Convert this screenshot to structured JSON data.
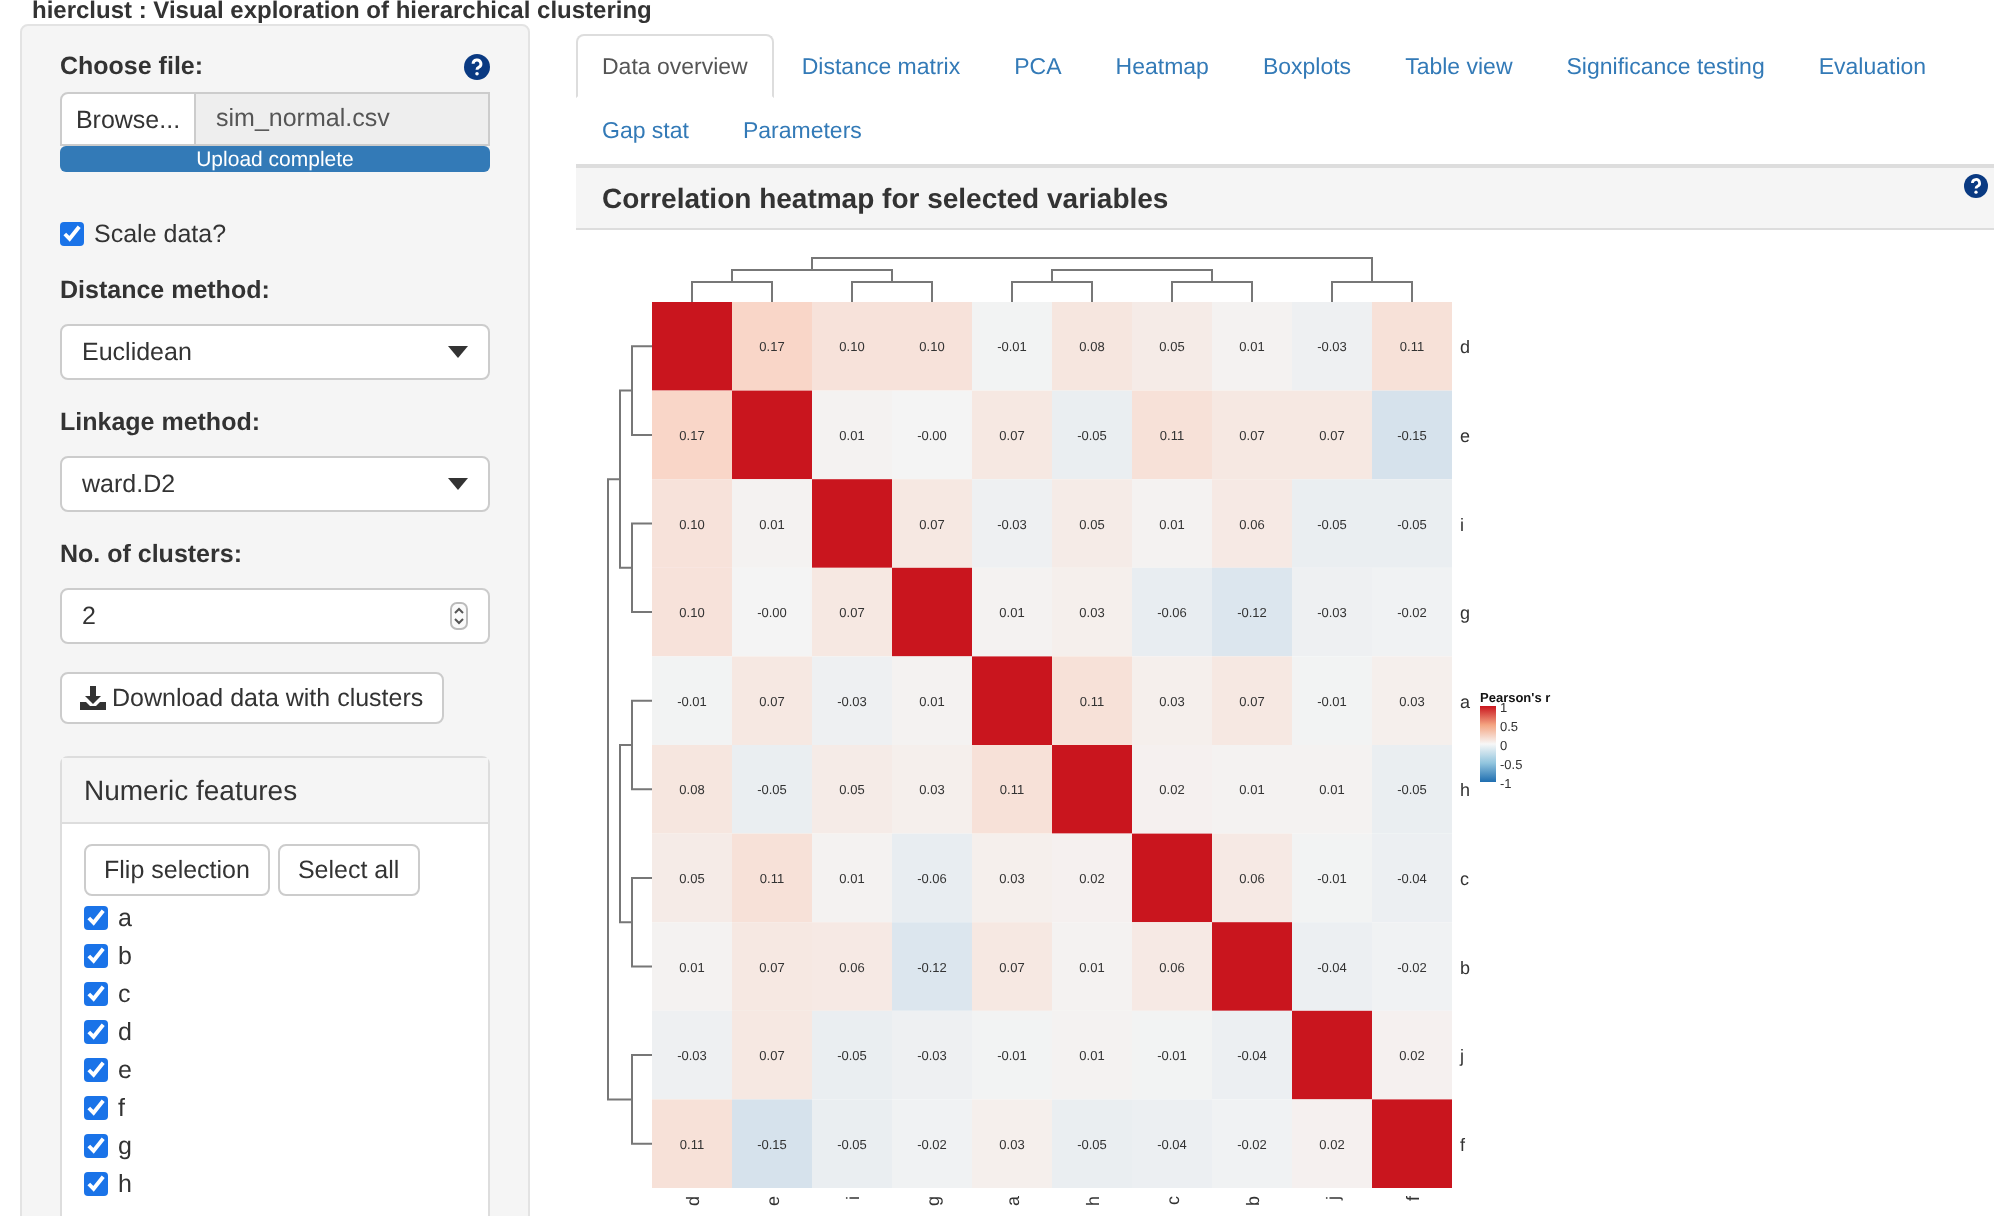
{
  "app_title": "hierclust : Visual exploration of hierarchical clustering",
  "sidebar": {
    "file_label": "Choose file:",
    "browse_button": "Browse...",
    "file_name": "sim_normal.csv",
    "upload": {
      "text": "Upload complete",
      "level": 1
    },
    "scale": {
      "label": "Scale data?",
      "checked": true
    },
    "distance": {
      "label": "Distance method:",
      "value": "Euclidean"
    },
    "linkage": {
      "label": "Linkage method:",
      "value": "ward.D2"
    },
    "clusters": {
      "label": "No. of clusters:",
      "value": "2"
    },
    "download_button": "Download data with clusters",
    "features": {
      "title": "Numeric features",
      "buttons": [
        "Flip selection",
        "Select all"
      ],
      "items": [
        {
          "label": "a",
          "checked": true
        },
        {
          "label": "b",
          "checked": true
        },
        {
          "label": "c",
          "checked": true
        },
        {
          "label": "d",
          "checked": true
        },
        {
          "label": "e",
          "checked": true
        },
        {
          "label": "f",
          "checked": true
        },
        {
          "label": "g",
          "checked": true
        },
        {
          "label": "h",
          "checked": true
        }
      ]
    }
  },
  "tabs": [
    [
      {
        "label": "Data overview",
        "selected": true
      },
      {
        "label": "Distance matrix",
        "selected": false
      },
      {
        "label": "PCA",
        "selected": false
      },
      {
        "label": "Heatmap",
        "selected": false
      },
      {
        "label": "Boxplots",
        "selected": false
      },
      {
        "label": "Table view",
        "selected": false
      },
      {
        "label": "Significance testing",
        "selected": false
      },
      {
        "label": "Evaluation",
        "selected": false
      }
    ],
    [
      {
        "label": "Gap stat",
        "selected": false
      },
      {
        "label": "Parameters",
        "selected": false
      }
    ]
  ],
  "panel": {
    "title": "Correlation heatmap for selected variables",
    "heatmap": {
      "rows": [
        {
          "label": "d",
          "cells": [
            {
              "kind": "diagonal"
            },
            {
              "kind": "value",
              "text": "0.17"
            },
            {
              "kind": "value",
              "text": "0.10"
            },
            {
              "kind": "value",
              "text": "0.10"
            },
            {
              "kind": "value",
              "text": "-0.01"
            },
            {
              "kind": "value",
              "text": "0.08"
            },
            {
              "kind": "value",
              "text": "0.05"
            },
            {
              "kind": "value",
              "text": "0.01"
            },
            {
              "kind": "value",
              "text": "-0.03"
            },
            {
              "kind": "value",
              "text": "0.11"
            }
          ]
        },
        {
          "label": "e",
          "cells": [
            {
              "kind": "value",
              "text": "0.17"
            },
            {
              "kind": "diagonal"
            },
            {
              "kind": "value",
              "text": "0.01"
            },
            {
              "kind": "value",
              "text": "-0.00"
            },
            {
              "kind": "value",
              "text": "0.07"
            },
            {
              "kind": "value",
              "text": "-0.05"
            },
            {
              "kind": "value",
              "text": "0.11"
            },
            {
              "kind": "value",
              "text": "0.07"
            },
            {
              "kind": "value",
              "text": "0.07"
            },
            {
              "kind": "value",
              "text": "-0.15"
            }
          ]
        },
        {
          "label": "i",
          "cells": [
            {
              "kind": "value",
              "text": "0.10"
            },
            {
              "kind": "value",
              "text": "0.01"
            },
            {
              "kind": "diagonal"
            },
            {
              "kind": "value",
              "text": "0.07"
            },
            {
              "kind": "value",
              "text": "-0.03"
            },
            {
              "kind": "value",
              "text": "0.05"
            },
            {
              "kind": "value",
              "text": "0.01"
            },
            {
              "kind": "value",
              "text": "0.06"
            },
            {
              "kind": "value",
              "text": "-0.05"
            },
            {
              "kind": "value",
              "text": "-0.05"
            }
          ]
        },
        {
          "label": "g",
          "cells": [
            {
              "kind": "value",
              "text": "0.10"
            },
            {
              "kind": "value",
              "text": "-0.00"
            },
            {
              "kind": "value",
              "text": "0.07"
            },
            {
              "kind": "diagonal"
            },
            {
              "kind": "value",
              "text": "0.01"
            },
            {
              "kind": "value",
              "text": "0.03"
            },
            {
              "kind": "value",
              "text": "-0.06"
            },
            {
              "kind": "value",
              "text": "-0.12"
            },
            {
              "kind": "value",
              "text": "-0.03"
            },
            {
              "kind": "value",
              "text": "-0.02"
            }
          ]
        },
        {
          "label": "a",
          "cells": [
            {
              "kind": "value",
              "text": "-0.01"
            },
            {
              "kind": "value",
              "text": "0.07"
            },
            {
              "kind": "value",
              "text": "-0.03"
            },
            {
              "kind": "value",
              "text": "0.01"
            },
            {
              "kind": "diagonal"
            },
            {
              "kind": "value",
              "text": "0.11"
            },
            {
              "kind": "value",
              "text": "0.03"
            },
            {
              "kind": "value",
              "text": "0.07"
            },
            {
              "kind": "value",
              "text": "-0.01"
            },
            {
              "kind": "value",
              "text": "0.03"
            }
          ]
        },
        {
          "label": "h",
          "cells": [
            {
              "kind": "value",
              "text": "0.08"
            },
            {
              "kind": "value",
              "text": "-0.05"
            },
            {
              "kind": "value",
              "text": "0.05"
            },
            {
              "kind": "value",
              "text": "0.03"
            },
            {
              "kind": "value",
              "text": "0.11"
            },
            {
              "kind": "diagonal"
            },
            {
              "kind": "value",
              "text": "0.02"
            },
            {
              "kind": "value",
              "text": "0.01"
            },
            {
              "kind": "value",
              "text": "0.01"
            },
            {
              "kind": "value",
              "text": "-0.05"
            }
          ]
        },
        {
          "label": "c",
          "cells": [
            {
              "kind": "value",
              "text": "0.05"
            },
            {
              "kind": "value",
              "text": "0.11"
            },
            {
              "kind": "value",
              "text": "0.01"
            },
            {
              "kind": "value",
              "text": "-0.06"
            },
            {
              "kind": "value",
              "text": "0.03"
            },
            {
              "kind": "value",
              "text": "0.02"
            },
            {
              "kind": "diagonal"
            },
            {
              "kind": "value",
              "text": "0.06"
            },
            {
              "kind": "value",
              "text": "-0.01"
            },
            {
              "kind": "value",
              "text": "-0.04"
            }
          ]
        },
        {
          "label": "b",
          "cells": [
            {
              "kind": "value",
              "text": "0.01"
            },
            {
              "kind": "value",
              "text": "0.07"
            },
            {
              "kind": "value",
              "text": "0.06"
            },
            {
              "kind": "value",
              "text": "-0.12"
            },
            {
              "kind": "value",
              "text": "0.07"
            },
            {
              "kind": "value",
              "text": "0.01"
            },
            {
              "kind": "value",
              "text": "0.06"
            },
            {
              "kind": "diagonal"
            },
            {
              "kind": "value",
              "text": "-0.04"
            },
            {
              "kind": "value",
              "text": "-0.02"
            }
          ]
        },
        {
          "label": "j",
          "cells": [
            {
              "kind": "value",
              "text": "-0.03"
            },
            {
              "kind": "value",
              "text": "0.07"
            },
            {
              "kind": "value",
              "text": "-0.05"
            },
            {
              "kind": "value",
              "text": "-0.03"
            },
            {
              "kind": "value",
              "text": "-0.01"
            },
            {
              "kind": "value",
              "text": "0.01"
            },
            {
              "kind": "value",
              "text": "-0.01"
            },
            {
              "kind": "value",
              "text": "-0.04"
            },
            {
              "kind": "diagonal"
            },
            {
              "kind": "value",
              "text": "0.02"
            }
          ]
        },
        {
          "label": "f",
          "cells": [
            {
              "kind": "value",
              "text": "0.11"
            },
            {
              "kind": "value",
              "text": "-0.15"
            },
            {
              "kind": "value",
              "text": "-0.05"
            },
            {
              "kind": "value",
              "text": "-0.02"
            },
            {
              "kind": "value",
              "text": "0.03"
            },
            {
              "kind": "value",
              "text": "-0.05"
            },
            {
              "kind": "value",
              "text": "-0.04"
            },
            {
              "kind": "value",
              "text": "-0.02"
            },
            {
              "kind": "value",
              "text": "0.02"
            },
            {
              "kind": "diagonal"
            }
          ]
        }
      ],
      "bottom_axis_labels": [
        "d",
        "e",
        "i",
        "g",
        "a",
        "h",
        "c",
        "b",
        "j",
        "f"
      ],
      "legend": {
        "title": "Pearson's r",
        "ticks": [
          "1",
          "0.5",
          "0",
          "-0.5",
          "-1"
        ]
      }
    }
  }
}
